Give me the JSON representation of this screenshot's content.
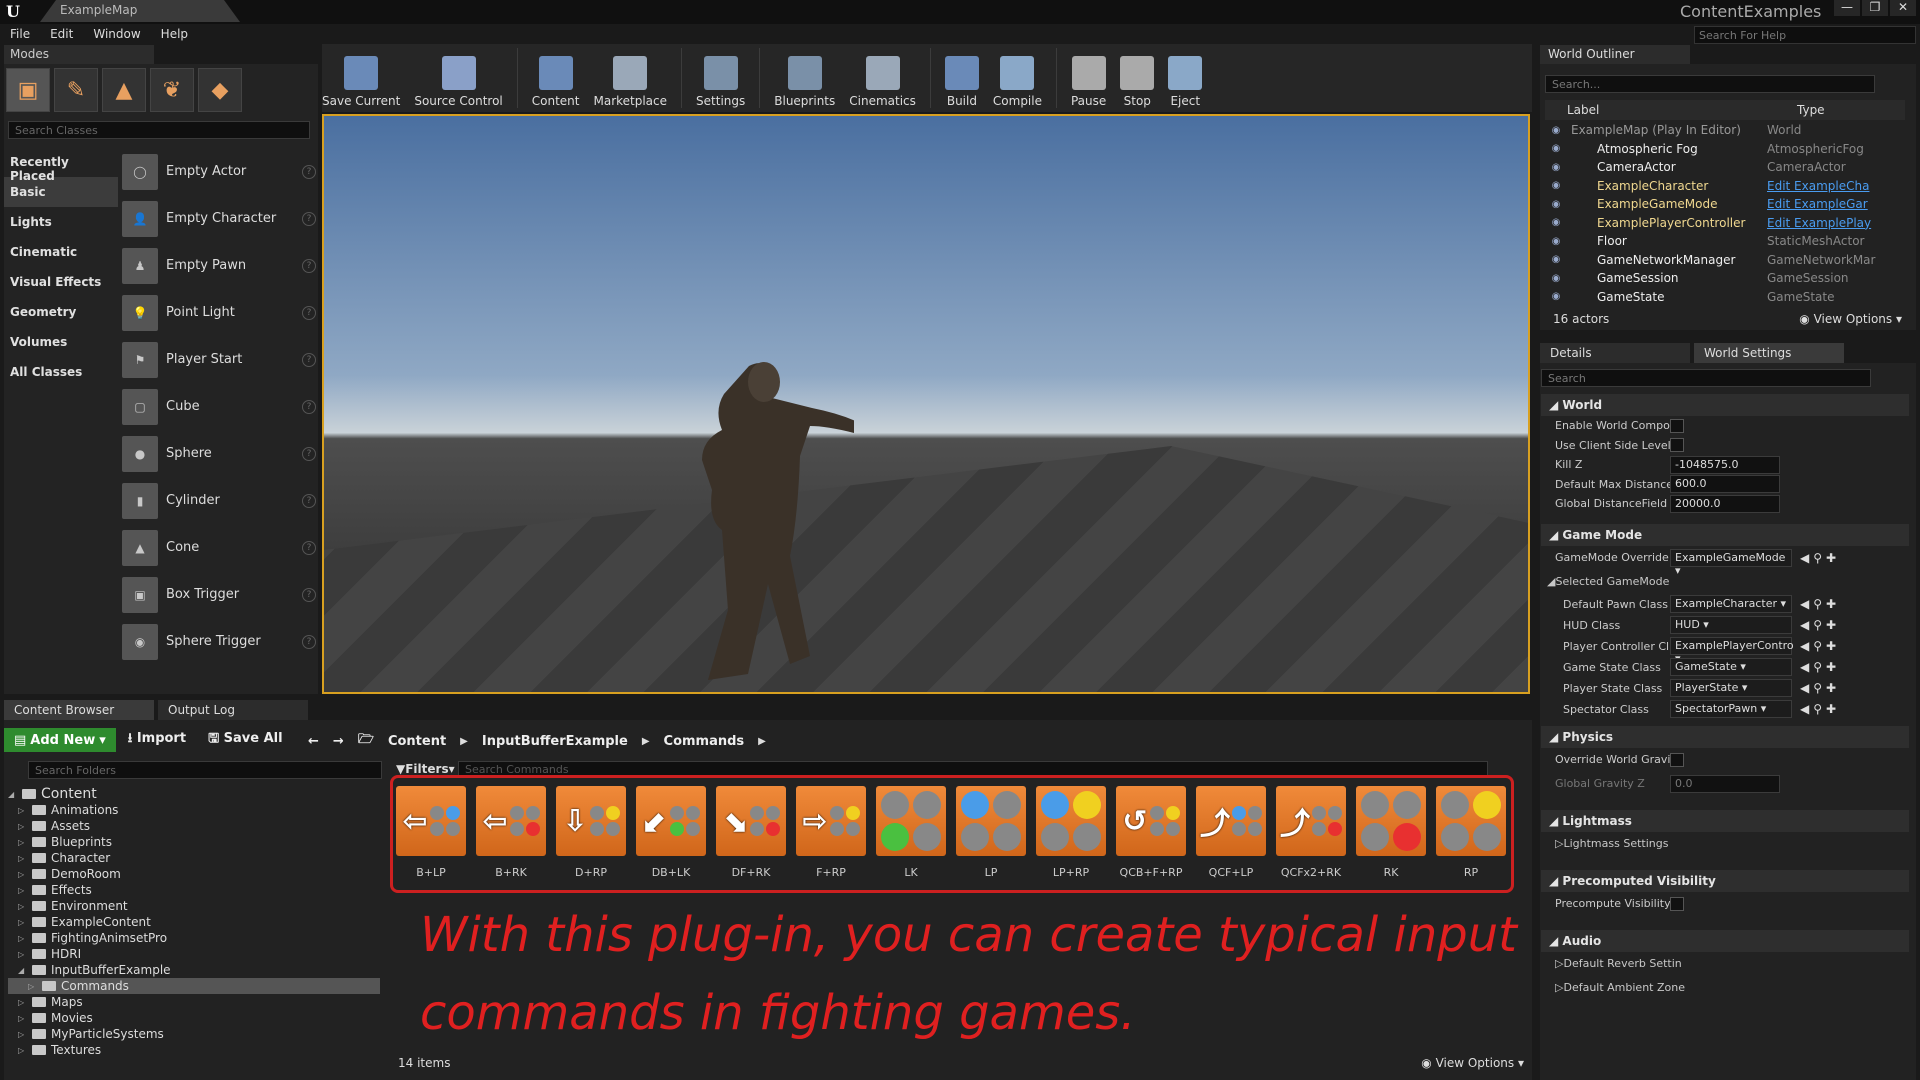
{
  "titlebar": {
    "doc_tab": "ExampleMap",
    "project": "ContentExamples",
    "help_search": "Search For Help"
  },
  "menu": [
    "File",
    "Edit",
    "Window",
    "Help"
  ],
  "modes": {
    "tab_label": "Modes",
    "search_placeholder": "Search Classes",
    "categories": [
      "Recently Placed",
      "Basic",
      "Lights",
      "Cinematic",
      "Visual Effects",
      "Geometry",
      "Volumes",
      "All Classes"
    ],
    "active_category": "Basic",
    "placeables": [
      "Empty Actor",
      "Empty Character",
      "Empty Pawn",
      "Point Light",
      "Player Start",
      "Cube",
      "Sphere",
      "Cylinder",
      "Cone",
      "Box Trigger",
      "Sphere Trigger"
    ]
  },
  "toolbar": [
    "Save Current",
    "Source Control",
    "Content",
    "Marketplace",
    "Settings",
    "Blueprints",
    "Cinematics",
    "Build",
    "Compile",
    "Pause",
    "Stop",
    "Eject"
  ],
  "world_outliner": {
    "tab": "World Outliner",
    "search_placeholder": "Search...",
    "col_label": "Label",
    "col_type": "Type",
    "rows": [
      {
        "label": "ExampleMap (Play In Editor)",
        "type": "World",
        "link": false
      },
      {
        "label": "Atmospheric Fog",
        "type": "AtmosphericFog",
        "link": false
      },
      {
        "label": "CameraActor",
        "type": "CameraActor",
        "link": false
      },
      {
        "label": "ExampleCharacter",
        "type": "Edit ExampleCha",
        "link": true
      },
      {
        "label": "ExampleGameMode",
        "type": "Edit ExampleGar",
        "link": true
      },
      {
        "label": "ExamplePlayerController",
        "type": "Edit ExamplePlay",
        "link": true
      },
      {
        "label": "Floor",
        "type": "StaticMeshActor",
        "link": false
      },
      {
        "label": "GameNetworkManager",
        "type": "GameNetworkMar",
        "link": false
      },
      {
        "label": "GameSession",
        "type": "GameSession",
        "link": false
      },
      {
        "label": "GameState",
        "type": "GameState",
        "link": false
      }
    ],
    "count": "16 actors",
    "view_options": "View Options"
  },
  "details": {
    "tabs": [
      "Details",
      "World Settings"
    ],
    "search_placeholder": "Search",
    "world_section": "World",
    "world_props": [
      {
        "label": "Enable World Compos",
        "kind": "check"
      },
      {
        "label": "Use Client Side Level",
        "kind": "check"
      },
      {
        "label": "Kill Z",
        "kind": "value",
        "value": "-1048575.0"
      },
      {
        "label": "Default Max Distance",
        "kind": "value",
        "value": "600.0"
      },
      {
        "label": "Global DistanceField \\",
        "kind": "value",
        "value": "20000.0"
      }
    ],
    "gamemode_section": "Game Mode",
    "gamemode_override_label": "GameMode Override",
    "gamemode_override_value": "ExampleGameMode",
    "selected_gamemode": "Selected GameMode",
    "gamemode_props": [
      {
        "label": "Default Pawn Class",
        "value": "ExampleCharacter"
      },
      {
        "label": "HUD Class",
        "value": "HUD"
      },
      {
        "label": "Player Controller Cl",
        "value": "ExamplePlayerContro"
      },
      {
        "label": "Game State Class",
        "value": "GameState"
      },
      {
        "label": "Player State Class",
        "value": "PlayerState"
      },
      {
        "label": "Spectator Class",
        "value": "SpectatorPawn"
      }
    ],
    "physics_section": "Physics",
    "override_gravity": "Override World Gravity",
    "global_gravity_label": "Global Gravity Z",
    "global_gravity_value": "0.0",
    "lightmass_section": "Lightmass",
    "lightmass_settings": "Lightmass Settings",
    "precomputed_section": "Precomputed Visibility",
    "precompute_visibility": "Precompute Visibility",
    "audio_section": "Audio",
    "audio_props": [
      "Default Reverb Settin",
      "Default Ambient Zone"
    ]
  },
  "content_browser": {
    "tabs": [
      "Content Browser",
      "Output Log"
    ],
    "add_new": "Add New",
    "import": "Import",
    "save_all": "Save All",
    "breadcrumb": [
      "Content",
      "InputBufferExample",
      "Commands"
    ],
    "search_folders": "Search Folders",
    "filters": "Filters",
    "search_commands": "Search Commands",
    "folders": [
      {
        "name": "Content",
        "depth": 0,
        "expanded": true
      },
      {
        "name": "Animations",
        "depth": 1
      },
      {
        "name": "Assets",
        "depth": 1
      },
      {
        "name": "Blueprints",
        "depth": 1
      },
      {
        "name": "Character",
        "depth": 1
      },
      {
        "name": "DemoRoom",
        "depth": 1
      },
      {
        "name": "Effects",
        "depth": 1
      },
      {
        "name": "Environment",
        "depth": 1
      },
      {
        "name": "ExampleContent",
        "depth": 1
      },
      {
        "name": "FightingAnimsetPro",
        "depth": 1
      },
      {
        "name": "HDRI",
        "depth": 1
      },
      {
        "name": "InputBufferExample",
        "depth": 1,
        "expanded": true
      },
      {
        "name": "Commands",
        "depth": 2,
        "active": true
      },
      {
        "name": "Maps",
        "depth": 1
      },
      {
        "name": "Movies",
        "depth": 1
      },
      {
        "name": "MyParticleSystems",
        "depth": 1
      },
      {
        "name": "Textures",
        "depth": 1
      }
    ],
    "assets": [
      {
        "label": "B+LP",
        "arrow": "⇦",
        "dots": [
          "#888",
          "#4a9ce8",
          "#888",
          "#888"
        ]
      },
      {
        "label": "B+RK",
        "arrow": "⇦",
        "dots": [
          "#888",
          "#888",
          "#888",
          "#e83030"
        ]
      },
      {
        "label": "D+RP",
        "arrow": "⇩",
        "dots": [
          "#888",
          "#f0d020",
          "#888",
          "#888"
        ]
      },
      {
        "label": "DB+LK",
        "arrow": "⬋",
        "dots": [
          "#888",
          "#888",
          "#4ac040",
          "#888"
        ]
      },
      {
        "label": "DF+RK",
        "arrow": "⬊",
        "dots": [
          "#888",
          "#888",
          "#888",
          "#e83030"
        ]
      },
      {
        "label": "F+RP",
        "arrow": "⇨",
        "dots": [
          "#888",
          "#f0d020",
          "#888",
          "#888"
        ]
      },
      {
        "label": "LK",
        "arrow": "",
        "dots": [
          "#888",
          "#888",
          "#4ac040",
          "#888"
        ]
      },
      {
        "label": "LP",
        "arrow": "",
        "dots": [
          "#4a9ce8",
          "#888",
          "#888",
          "#888"
        ]
      },
      {
        "label": "LP+RP",
        "arrow": "",
        "dots": [
          "#4a9ce8",
          "#f0d020",
          "#888",
          "#888"
        ]
      },
      {
        "label": "QCB+F+RP",
        "arrow": "↺",
        "dots": [
          "#888",
          "#f0d020",
          "#888",
          "#888"
        ]
      },
      {
        "label": "QCF+LP",
        "arrow": "⤴",
        "dots": [
          "#4a9ce8",
          "#888",
          "#888",
          "#888"
        ]
      },
      {
        "label": "QCFx2+RK",
        "arrow": "⤴",
        "dots": [
          "#888",
          "#888",
          "#888",
          "#e83030"
        ]
      },
      {
        "label": "RK",
        "arrow": "",
        "dots": [
          "#888",
          "#888",
          "#888",
          "#e83030"
        ]
      },
      {
        "label": "RP",
        "arrow": "",
        "dots": [
          "#888",
          "#f0d020",
          "#888",
          "#888"
        ]
      }
    ],
    "annotation": "With this plug-in, you can create typical input commands in fighting games.",
    "item_count": "14 items",
    "view_options": "View Options"
  },
  "colors": {
    "accent_selection": "#d8a020",
    "annotation_red": "#e02020",
    "add_new_green": "#2e8b2e",
    "asset_orange": "#e8782a",
    "link_blue": "#4a9cf0"
  }
}
